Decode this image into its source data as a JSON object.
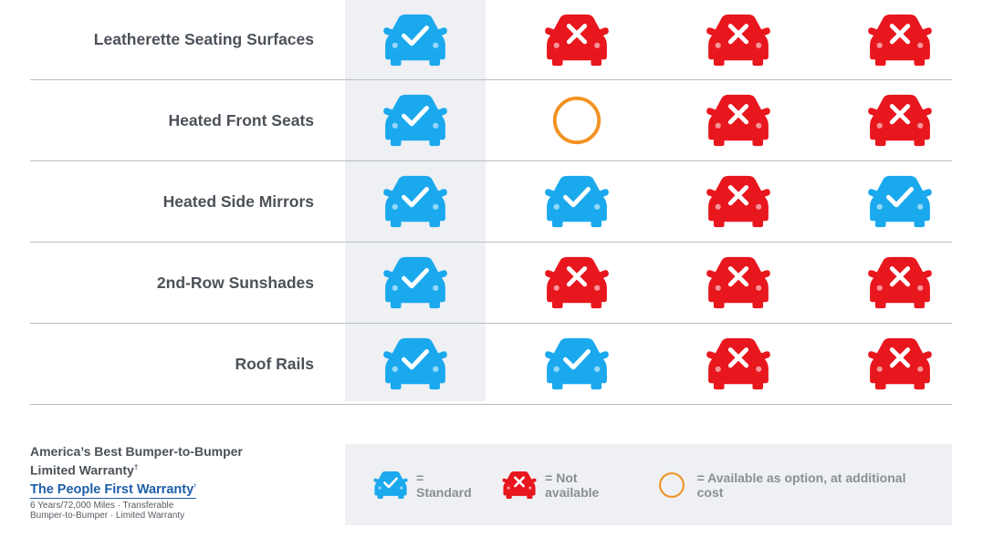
{
  "colors": {
    "standard": "#1ba9ee",
    "not_available": "#e8161d",
    "option": "#f29222",
    "shade": "#eef0f3",
    "divider": "#b8bcc1",
    "brand": "#1d5fa8"
  },
  "icons": {
    "standard": "car-check-icon",
    "not_available": "car-x-icon",
    "option": "circle-outline-icon"
  },
  "rows": [
    {
      "label": "Leatherette Seating Surfaces",
      "cells": [
        "standard",
        "not_available",
        "not_available",
        "not_available"
      ]
    },
    {
      "label": "Heated Front Seats",
      "cells": [
        "standard",
        "option",
        "not_available",
        "not_available"
      ]
    },
    {
      "label": "Heated Side Mirrors",
      "cells": [
        "standard",
        "standard",
        "not_available",
        "standard"
      ]
    },
    {
      "label": "2nd-Row Sunshades",
      "cells": [
        "standard",
        "not_available",
        "not_available",
        "not_available"
      ]
    },
    {
      "label": "Roof Rails",
      "cells": [
        "standard",
        "standard",
        "not_available",
        "not_available"
      ]
    }
  ],
  "warranty": {
    "title_line1": "America’s Best Bumper-to-Bumper",
    "title_line2": "Limited Warranty",
    "title_mark": "†",
    "brand": "The People First Warranty",
    "brand_mark": "†",
    "detail_line1": "6 Years/72,000 Miles · Transferable",
    "detail_line2": "Bumper-to-Bumper · Limited Warranty"
  },
  "legend": [
    {
      "status": "standard",
      "label": "= Standard"
    },
    {
      "status": "not_available",
      "label": "= Not available"
    },
    {
      "status": "option",
      "label": "= Available as option, at additional cost"
    }
  ]
}
